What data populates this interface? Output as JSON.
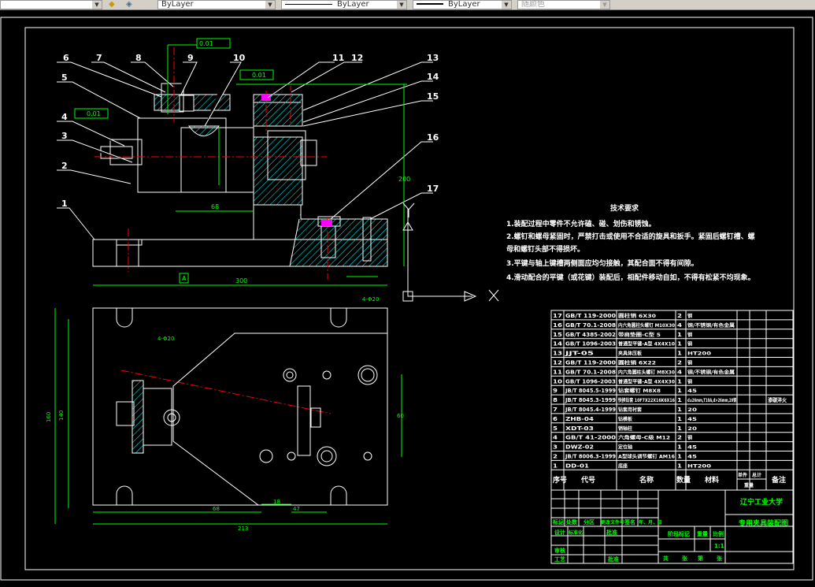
{
  "toolbar": {
    "layer_color": "ByLayer",
    "linetype": "ByLayer",
    "lineweight": "ByLayer",
    "plot_style": "随颜色"
  },
  "drawing": {
    "part_labels": [
      "1",
      "2",
      "3",
      "4",
      "5",
      "6",
      "7",
      "8",
      "9",
      "10",
      "11",
      "12",
      "13",
      "14",
      "15",
      "16",
      "17"
    ],
    "tolerances": [
      "0.01",
      "0.01",
      "0.01"
    ],
    "datum": "A",
    "dims": {
      "front_width": "300",
      "height": "200",
      "bottom_width": "213",
      "plan_height": "160",
      "plan_inner": "140",
      "d1": "68",
      "d2": "18",
      "d3": "47",
      "side": "60",
      "holes": "4-Φ20"
    },
    "axis_x": "X",
    "axis_y": "Y"
  },
  "tech": {
    "title": "技术要求",
    "lines": [
      "1.装配过程中零件不允许磕、碰、划伤和锈蚀。",
      "2.螺钉和螺母紧固时，严禁打击或使用不合适的旋具和扳手。紧固后螺钉槽、螺",
      "母和螺钉头部不得损坏。",
      "3.平键与轴上键槽两侧面应均匀接触，其配合面不得有间隙。",
      "4.滑动配合的平键（或花键）装配后，相配件移动自如，不得有松紧不均现象。"
    ]
  },
  "parts": [
    [
      "17",
      "GB/T 119-2000",
      "圆柱销 6X30",
      "2",
      "钢",
      "",
      "",
      ""
    ],
    [
      "16",
      "GB/T 70.1-2008",
      "内六角圆柱头螺钉 M10X30",
      "4",
      "钢/不锈钢/有色金属",
      "",
      "",
      ""
    ],
    [
      "15",
      "GB/T 4385-2002",
      "带肩垫圈-C型 5",
      "1",
      "钢",
      "",
      "",
      ""
    ],
    [
      "14",
      "GB/T 1096-2003",
      "普通型平键-A型 4X4X10",
      "1",
      "钢",
      "",
      "",
      ""
    ],
    [
      "13",
      "JJT-05",
      "夹具体压板",
      "1",
      "HT200",
      "",
      "",
      ""
    ],
    [
      "12",
      "GB/T 119-2000",
      "圆柱销 6X22",
      "2",
      "钢",
      "",
      "",
      ""
    ],
    [
      "11",
      "GB/T 70.1-2008",
      "内六角圆柱头螺钉 M8X30",
      "4",
      "钢/不锈钢/有色金属",
      "",
      "",
      ""
    ],
    [
      "10",
      "GB/T 1096-2003",
      "普通型平键-A型 4X4X30",
      "1",
      "钢",
      "",
      "",
      ""
    ],
    [
      "9",
      "JB/T 8045.5-1999",
      "钻套螺钉 M8X8",
      "1",
      "45",
      "",
      "",
      ""
    ],
    [
      "8",
      "JB/T 8045.3-1999",
      "快换钻套 10F7X22X16K6X16",
      "1",
      "d≤26mm,T10A,d>26mm,20钢",
      "",
      "",
      "渗碳淬火"
    ],
    [
      "7",
      "JB/T 8045.4-1999",
      "钻套用衬套",
      "1",
      "20",
      "",
      "",
      ""
    ],
    [
      "6",
      "ZHB-04",
      "钻模板",
      "1",
      "45",
      "",
      "",
      ""
    ],
    [
      "5",
      "XDT-03",
      "销轴柱",
      "1",
      "20",
      "",
      "",
      ""
    ],
    [
      "4",
      "GB/T 41-2000",
      "六角螺母-C级 M12",
      "2",
      "钢",
      "",
      "",
      ""
    ],
    [
      "3",
      "DWZ-02",
      "定位轴",
      "1",
      "45",
      "",
      "",
      ""
    ],
    [
      "2",
      "JB/T 8006.3-1999",
      "A型球头调节螺钉 AM16",
      "1",
      "45",
      "",
      "",
      ""
    ],
    [
      "1",
      "DD-01",
      "底座",
      "1",
      "HT200",
      "",
      "",
      ""
    ]
  ],
  "parts_header": {
    "no": "序号",
    "code": "代号",
    "name": "名称",
    "qty": "数量",
    "material": "材料",
    "unit": "单件",
    "total": "总计",
    "weight": "重量",
    "remark": "备注"
  },
  "title_block": {
    "school": "辽宁工业大学",
    "drawing_title": "专用夹具装配图",
    "row_labels": [
      "标记",
      "处数",
      "分区",
      "更改文件号",
      "签名",
      "年、月、日"
    ],
    "design": "设计",
    "standardize": "标准化",
    "approve": "批准",
    "check": "审核",
    "process": "工艺",
    "stage": "阶段标记",
    "weight": "重量",
    "scale": "比例",
    "scale_value": "1:1",
    "sheets": [
      "共",
      "张",
      "第",
      "张"
    ]
  }
}
